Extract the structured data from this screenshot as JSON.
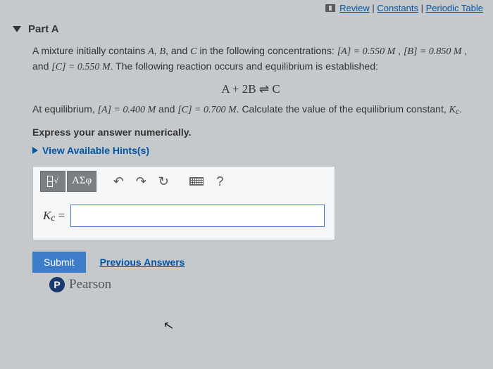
{
  "topLinks": {
    "review": "Review",
    "constants": "Constants",
    "periodic": "Periodic Table"
  },
  "part": {
    "label": "Part A"
  },
  "problem": {
    "line1_pre": "A mixture initially contains ",
    "line1_mid": ", and ",
    "line1_post": " in the following concentrations: ",
    "conc_a": "[A] = 0.550 ",
    "conc_b": "[B] = 0.850 ",
    "conc_c": "[C] = 0.550 ",
    "sentence2": ". The following reaction occurs and equilibrium is established:",
    "equation": "A + 2B ⇌ C",
    "eq_line_pre": "At equilibrium, ",
    "eq_a": "[A] = 0.400 ",
    "eq_and": " and ",
    "eq_c": "[C] = 0.700 ",
    "eq_line_post": ". Calculate the value of the equilibrium constant, ",
    "kc": "K",
    "kc_sub": "c",
    "period": "."
  },
  "instruction": "Express your answer numerically.",
  "hints": "View Available Hints(s)",
  "toolbar": {
    "templates": "",
    "sqrt": "√",
    "greek": "ΑΣφ",
    "undo": "↶",
    "redo": "↷",
    "reset": "↻",
    "keyboard": "",
    "help": "?"
  },
  "answer": {
    "label_prefix": "K",
    "label_sub": "c",
    "label_eq": " =",
    "value": ""
  },
  "submit": {
    "button": "Submit",
    "prev": "Previous Answers"
  },
  "footer": {
    "p": "P",
    "brand": "Pearson"
  }
}
